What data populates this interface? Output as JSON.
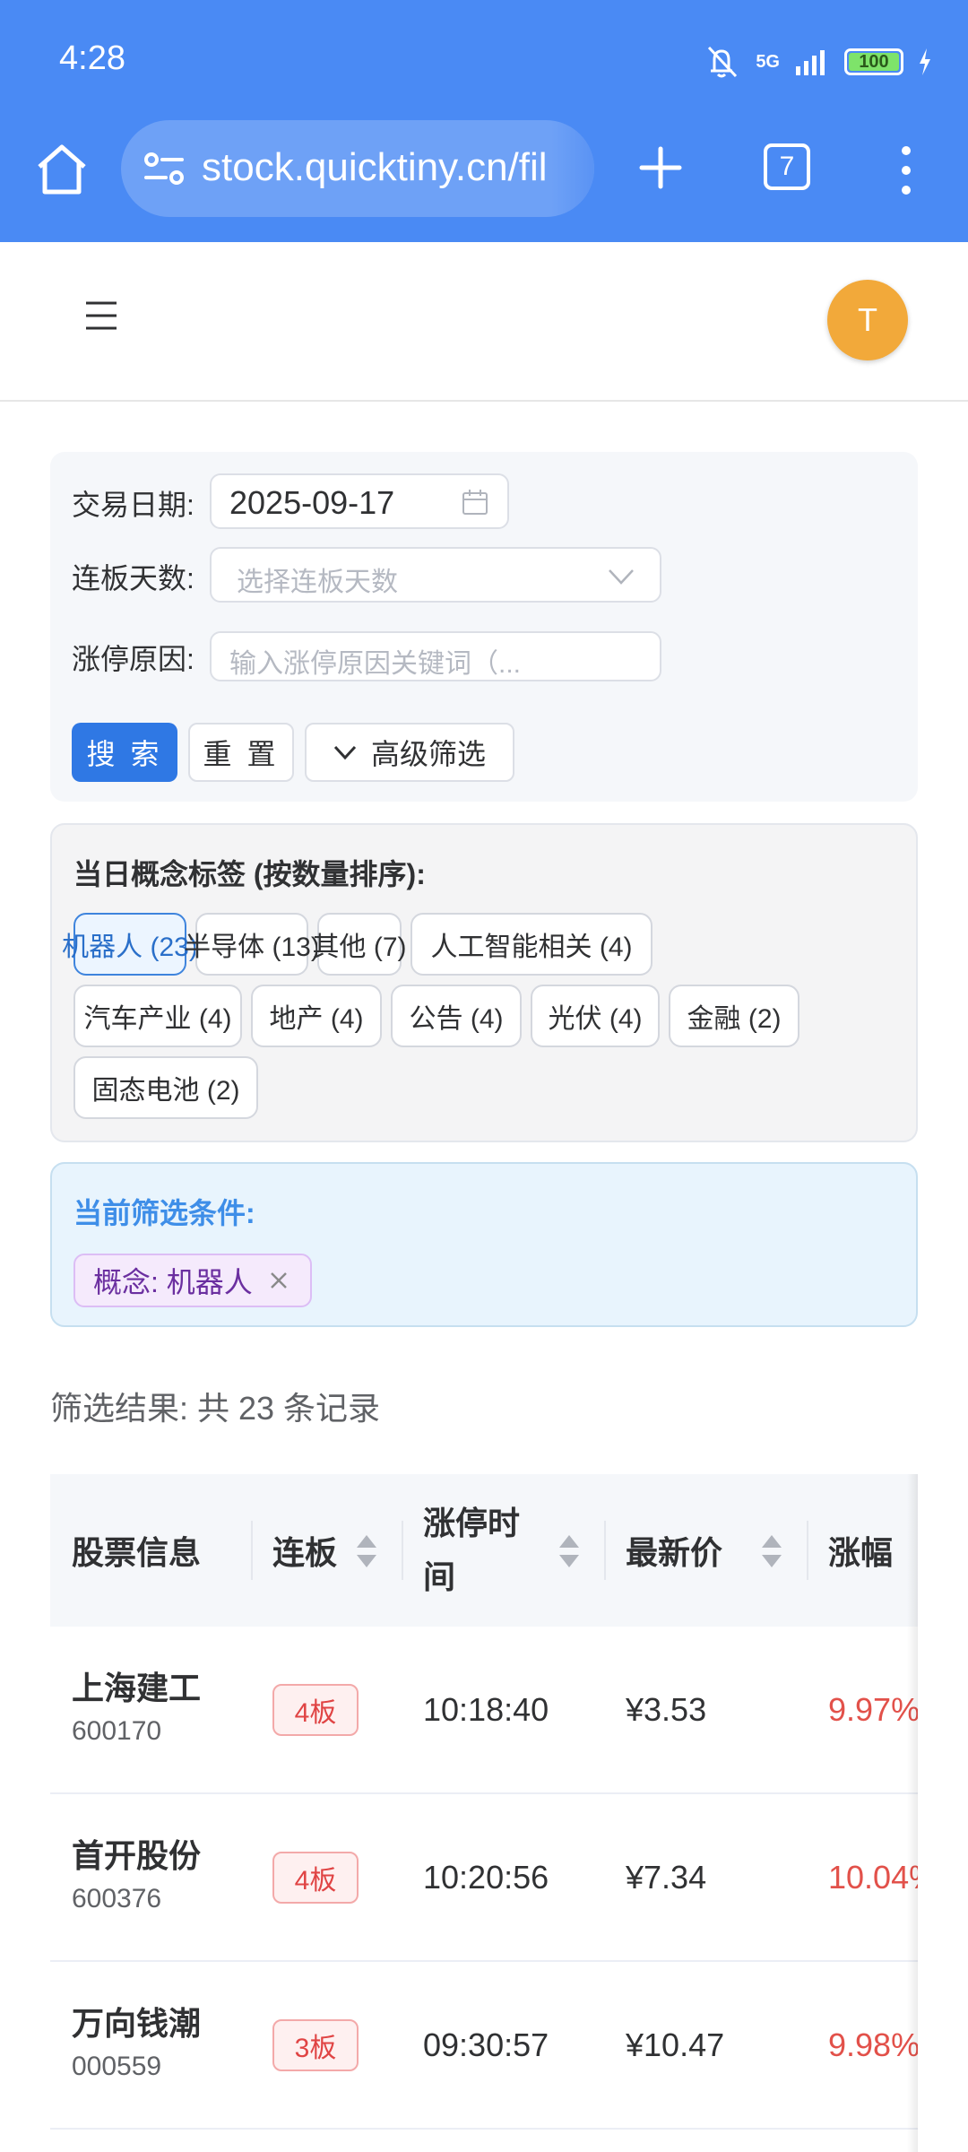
{
  "status_bar": {
    "time": "4:28",
    "network": "5G",
    "battery": "100"
  },
  "browser": {
    "url": "stock.quicktiny.cn/fil",
    "tab_count": "7"
  },
  "header": {
    "avatar_letter": "T"
  },
  "filters": {
    "date_label": "交易日期:",
    "date_value": "2025-09-17",
    "board_label": "连板天数:",
    "board_placeholder": "选择连板天数",
    "reason_label": "涨停原因:",
    "reason_placeholder": "输入涨停原因关键词（...",
    "search_button": "搜 索",
    "reset_button": "重 置",
    "advanced_button": "高级筛选"
  },
  "concepts": {
    "title": "当日概念标签 (按数量排序):",
    "tags": [
      "机器人 (23)",
      "半导体 (13)",
      "其他 (7)",
      "人工智能相关 (4)",
      "汽车产业 (4)",
      "地产 (4)",
      "公告 (4)",
      "光伏 (4)",
      "金融 (2)",
      "固态电池 (2)"
    ],
    "active_tag": "机器人 (23)"
  },
  "current_filter": {
    "title": "当前筛选条件:",
    "chip": "概念: 机器人"
  },
  "result_count": "筛选结果: 共 23 条记录",
  "table": {
    "headers": {
      "info": "股票信息",
      "board": "连板",
      "time": "涨停时间",
      "price": "最新价",
      "change": "涨幅"
    },
    "rows": [
      {
        "name": "上海建工",
        "code": "600170",
        "board": "4板",
        "time": "10:18:40",
        "price": "¥3.53",
        "change": "9.97%"
      },
      {
        "name": "首开股份",
        "code": "600376",
        "board": "4板",
        "time": "10:20:56",
        "price": "¥7.34",
        "change": "10.04%"
      },
      {
        "name": "万向钱潮",
        "code": "000559",
        "board": "3板",
        "time": "09:30:57",
        "price": "¥10.47",
        "change": "9.98%"
      }
    ]
  },
  "colors": {
    "chrome": "#4a8af4",
    "primary": "#2f78e4",
    "avatar": "#f2a93a",
    "rise": "#e2514a"
  }
}
